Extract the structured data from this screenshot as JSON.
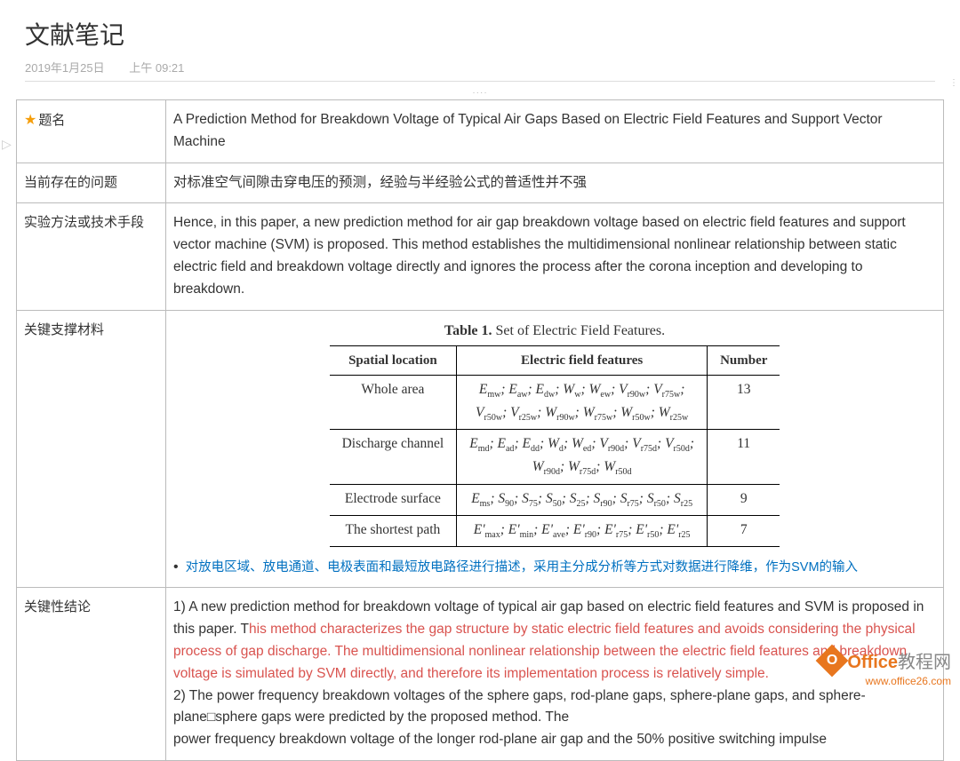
{
  "header": {
    "title": "文献笔记",
    "date": "2019年1月25日",
    "time": "上午 09:21"
  },
  "rows": {
    "r1": {
      "label": "题名",
      "value": "A Prediction Method for Breakdown Voltage of Typical Air Gaps Based on Electric Field Features and Support Vector Machine"
    },
    "r2": {
      "label": "当前存在的问题",
      "value": "对标准空气间隙击穿电压的预测，经验与半经验公式的普适性并不强"
    },
    "r3": {
      "label": "实验方法或技术手段",
      "value": "Hence, in this paper, a new prediction method for air gap breakdown voltage based on electric field features and support vector machine (SVM) is proposed. This method establishes the multidimensional nonlinear relationship between static electric field and breakdown voltage directly and ignores the process after the corona inception and developing to breakdown."
    },
    "r4": {
      "label": "关键支撑材料",
      "note": "对放电区域、放电通道、电极表面和最短放电路径进行描述，采用主分成分析等方式对数据进行降维，作为SVM的输入"
    },
    "r5": {
      "label": "关键性结论",
      "p1_lead": "1) A new prediction method for breakdown voltage of typical air gap based on electric field features and SVM is proposed in this paper. T",
      "p1_red": "his method characterizes the gap structure by static electric field features and avoids considering the physical process of gap discharge. The multidimensional nonlinear relationship between the electric field features and breakdown voltage is simulated by SVM directly, and therefore its implementation process is relatively simple.",
      "p2": "2) The power frequency breakdown voltages of the sphere gaps, rod-plane gaps, sphere-plane gaps, and sphere-plane□sphere gaps were predicted by the proposed method. The",
      "p3": "power frequency breakdown voltage of the longer rod-plane air gap and the 50% positive switching impulse"
    }
  },
  "chart_data": {
    "type": "table",
    "title": "Table 1. Set of Electric Field Features.",
    "columns": [
      "Spatial location",
      "Electric field features",
      "Number"
    ],
    "rows": [
      {
        "loc": "Whole area",
        "features": "Emw; Eaw; Edw; Ww; Wew; Vr90w; Vr75w; Vr50w; Vr25w; Wr90w; Wr75w; Wr50w; Wr25w",
        "num": 13
      },
      {
        "loc": "Discharge channel",
        "features": "Emd; Ead; Edd; Wd; Wed; Vr90d; Vr75d; Vr50d; Wr90d; Wr75d; Wr50d",
        "num": 11
      },
      {
        "loc": "Electrode surface",
        "features": "Ems; S90; S75; S50; S25; Sr90; Sr75; Sr50; Sr25",
        "num": 9
      },
      {
        "loc": "The shortest path",
        "features": "E'max; E'min; E'ave; E'r90; E'r75; E'r50; E'r25",
        "num": 7
      }
    ]
  },
  "inner_table": {
    "caption_bold": "Table 1.",
    "caption_rest": " Set of Electric Field Features.",
    "h1": "Spatial location",
    "h2": "Electric field features",
    "h3": "Number",
    "r1_loc": "Whole area",
    "r1_num": "13",
    "r2_loc": "Discharge channel",
    "r2_num": "11",
    "r3_loc": "Electrode surface",
    "r3_num": "9",
    "r4_loc": "The shortest path",
    "r4_num": "7"
  },
  "watermark": {
    "brand_a": "Office",
    "brand_b": "教程网",
    "url": "www.office26.com"
  }
}
